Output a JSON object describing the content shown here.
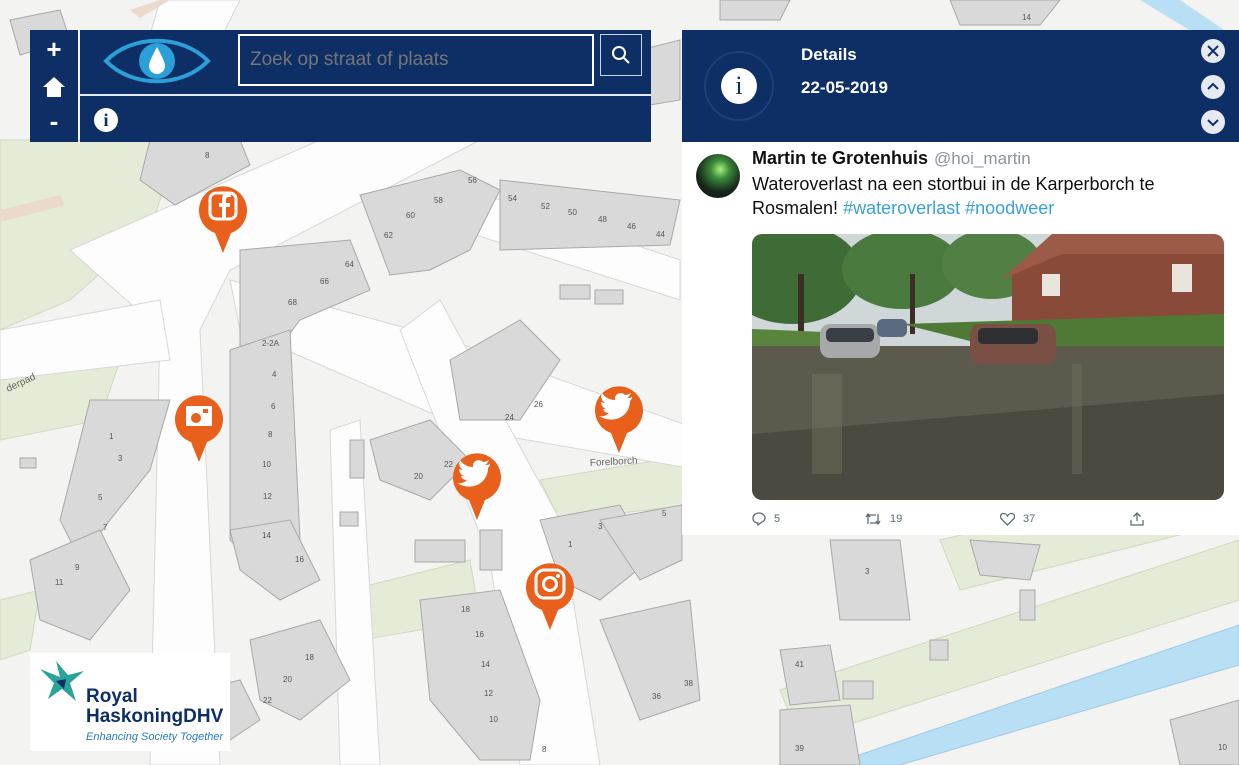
{
  "map": {
    "street_labels": [
      "Forelborch",
      "derpad"
    ],
    "house_numbers": [
      "8",
      "56",
      "54",
      "52",
      "50",
      "48",
      "46",
      "44",
      "62",
      "60",
      "58",
      "66",
      "64",
      "68",
      "2-2A",
      "4",
      "6",
      "8",
      "10",
      "12",
      "14",
      "16",
      "24",
      "26",
      "20",
      "22",
      "1",
      "3",
      "5",
      "7",
      "9",
      "11",
      "18",
      "16",
      "14",
      "12",
      "10",
      "8",
      "18",
      "20",
      "22",
      "3",
      "5",
      "1",
      "3",
      "36",
      "38",
      "41",
      "39",
      "10",
      "14"
    ],
    "colors": {
      "building": "#d9d9d9",
      "building_stroke": "#a8a8a8",
      "road": "#fbfbfb",
      "green": "#e4ecd7",
      "water": "#b8dff3",
      "path": "#ead9cc"
    }
  },
  "toolbar": {
    "zoom_in_label": "+",
    "zoom_out_label": "-",
    "home_icon": "home-icon",
    "logo_icon": "eye-water-drop-icon",
    "search_placeholder": "Zoek op straat of plaats",
    "search_icon": "search-icon",
    "info_icon": "info-icon"
  },
  "details": {
    "title": "Details",
    "date": "22-05-2019",
    "badge_icon": "info-icon",
    "controls": [
      "close-icon",
      "chevron-up-icon",
      "chevron-down-icon"
    ],
    "tweet": {
      "author": "Martin te Grotenhuis",
      "handle": "@hoi_martin",
      "text": "Wateroverlast na een stortbui in de Karperborch te Rosmalen!",
      "hashtags": [
        "#wateroverlast",
        "#noodweer"
      ],
      "photo_alt": "Flooded residential street with cars driving through water",
      "replies": "5",
      "retweets": "19",
      "likes": "37"
    }
  },
  "markers": [
    {
      "type": "facebook",
      "icon": "facebook-icon"
    },
    {
      "type": "photo",
      "icon": "camera-icon"
    },
    {
      "type": "twitter",
      "icon": "twitter-icon"
    },
    {
      "type": "twitter",
      "icon": "twitter-icon"
    },
    {
      "type": "instagram",
      "icon": "instagram-icon"
    }
  ],
  "marker_color": "#e8601c",
  "header_color": "#0d2f66",
  "logo": {
    "name_line1": "Royal",
    "name_line2": "HaskoningDHV",
    "tagline": "Enhancing Society Together"
  }
}
